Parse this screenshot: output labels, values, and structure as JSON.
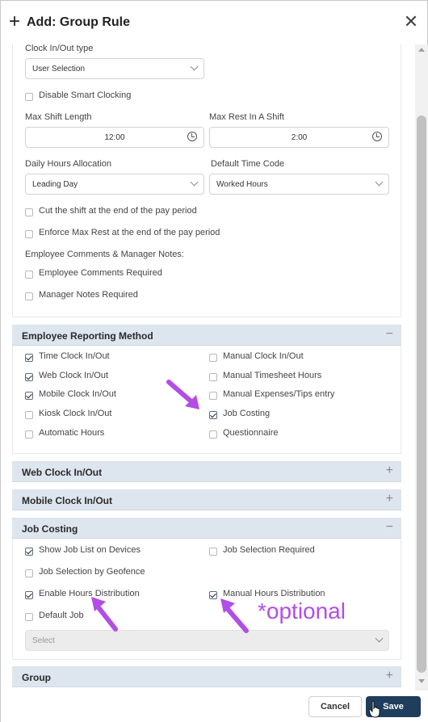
{
  "dialog": {
    "title": "Add: Group Rule",
    "close_icon": "close-icon",
    "add_icon": "plus-icon"
  },
  "general": {
    "clock_type_label": "Clock In/Out type",
    "clock_type_value": "User Selection",
    "disable_smart_clocking": "Disable Smart Clocking",
    "max_shift_label": "Max Shift Length",
    "max_shift_value": "12:00",
    "max_rest_label": "Max Rest In A Shift",
    "max_rest_value": "2:00",
    "daily_alloc_label": "Daily Hours Allocation",
    "daily_alloc_value": "Leading Day",
    "default_time_code_label": "Default Time Code",
    "default_time_code_value": "Worked Hours",
    "cut_shift": "Cut the shift at the end of the pay period",
    "enforce_max_rest": "Enforce Max Rest at the end of the pay period",
    "comments_notes_label": "Employee Comments & Manager Notes:",
    "employee_comments_required": "Employee Comments Required",
    "manager_notes_required": "Manager Notes Required"
  },
  "reporting": {
    "title": "Employee Reporting Method",
    "toggle": "−",
    "left": [
      {
        "label": "Time Clock In/Out",
        "checked": true
      },
      {
        "label": "Web Clock In/Out",
        "checked": true
      },
      {
        "label": "Mobile Clock In/Out",
        "checked": true
      },
      {
        "label": "Kiosk Clock In/Out",
        "checked": false
      },
      {
        "label": "Automatic Hours",
        "checked": false
      }
    ],
    "right": [
      {
        "label": "Manual Clock In/Out",
        "checked": false
      },
      {
        "label": "Manual Timesheet Hours",
        "checked": false
      },
      {
        "label": "Manual Expenses/Tips entry",
        "checked": false
      },
      {
        "label": "Job Costing",
        "checked": true
      },
      {
        "label": "Questionnaire",
        "checked": false
      }
    ]
  },
  "web_clock": {
    "title": "Web Clock In/Out",
    "toggle": "+"
  },
  "mobile_clock": {
    "title": "Mobile Clock In/Out",
    "toggle": "+"
  },
  "job_costing": {
    "title": "Job Costing",
    "toggle": "−",
    "show_job_list": "Show Job List on Devices",
    "job_selection_required": "Job Selection Required",
    "job_selection_geofence": "Job Selection by Geofence",
    "enable_hours_distribution": "Enable Hours Distribution",
    "manual_hours_distribution": "Manual Hours Distribution",
    "default_job": "Default Job",
    "select_placeholder": "Select"
  },
  "group": {
    "title": "Group",
    "toggle": "+"
  },
  "annotation": {
    "optional_text": "*optional",
    "color": "#b24de6"
  },
  "footer": {
    "cancel_label": "Cancel",
    "save_label": "Save"
  }
}
